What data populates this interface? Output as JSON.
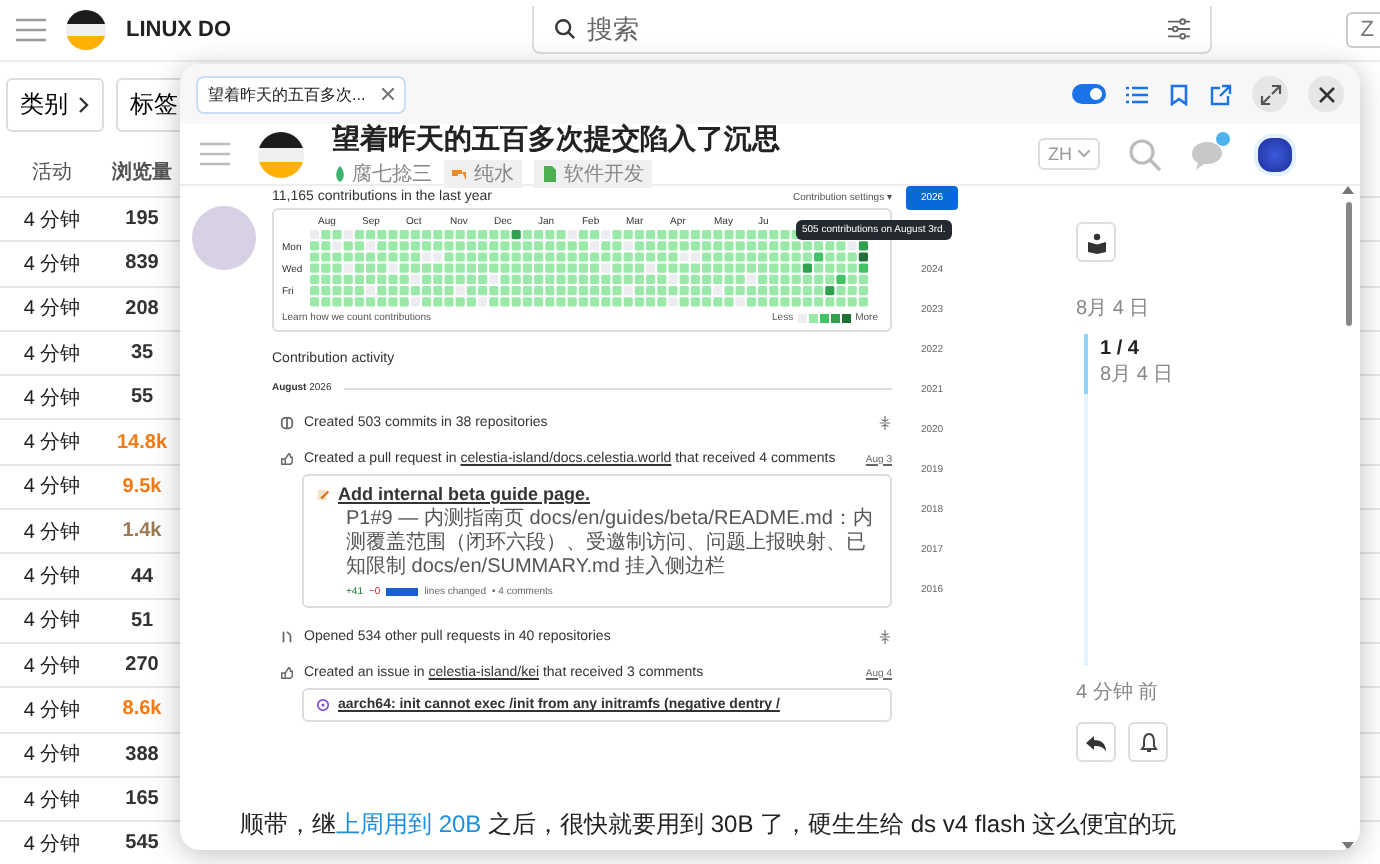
{
  "site": {
    "name": "LINUX DO",
    "search_placeholder": "搜索",
    "lang_partial": "Z"
  },
  "filters": [
    {
      "label": "类别"
    },
    {
      "label": "标签"
    }
  ],
  "table": {
    "columns": [
      "活动",
      "浏览量"
    ],
    "rows": [
      {
        "activity": "4 分钟",
        "views": "195",
        "color": "#333333"
      },
      {
        "activity": "4 分钟",
        "views": "839",
        "color": "#333333"
      },
      {
        "activity": "4 分钟",
        "views": "208",
        "color": "#333333"
      },
      {
        "activity": "4 分钟",
        "views": "35",
        "color": "#333333"
      },
      {
        "activity": "4 分钟",
        "views": "55",
        "color": "#333333"
      },
      {
        "activity": "4 分钟",
        "views": "14.8k",
        "color": "#f27b13"
      },
      {
        "activity": "4 分钟",
        "views": "9.5k",
        "color": "#f27b13"
      },
      {
        "activity": "4 分钟",
        "views": "1.4k",
        "color": "#9c7a54"
      },
      {
        "activity": "4 分钟",
        "views": "44",
        "color": "#333333"
      },
      {
        "activity": "4 分钟",
        "views": "51",
        "color": "#333333"
      },
      {
        "activity": "4 分钟",
        "views": "270",
        "color": "#333333"
      },
      {
        "activity": "4 分钟",
        "views": "8.6k",
        "color": "#f27b13"
      },
      {
        "activity": "4 分钟",
        "views": "388",
        "color": "#333333"
      },
      {
        "activity": "4 分钟",
        "views": "165",
        "color": "#333333"
      },
      {
        "activity": "4 分钟",
        "views": "545",
        "color": "#333333"
      }
    ]
  },
  "popup": {
    "tab": {
      "label": "望着昨天的五百多次..."
    },
    "toggle_on": true,
    "topic": {
      "title": "望着昨天的五百多次提交陷入了沉思",
      "author": "腐七捻三",
      "tags": [
        {
          "label": "纯水",
          "kind": "water"
        },
        {
          "label": "软件开发",
          "kind": "doc"
        }
      ]
    },
    "lang": "ZH",
    "has_unread": true,
    "screenshot": {
      "summary": "11,165 contributions in the last year",
      "settings": "Contribution settings",
      "settings_caret": "▾",
      "months": [
        "Aug",
        "Sep",
        "Oct",
        "Nov",
        "Dec",
        "Jan",
        "Feb",
        "Mar",
        "Apr",
        "May",
        "Ju"
      ],
      "days": [
        "Mon",
        "Wed",
        "Fri"
      ],
      "learn": "Learn how we count contributions",
      "less": "Less",
      "more": "More",
      "tooltip": "505 contributions on August 3rd.",
      "years": [
        {
          "label": "2026",
          "selected": true
        },
        {
          "label": "2024",
          "selected": false
        },
        {
          "label": "2023",
          "selected": false
        },
        {
          "label": "2022",
          "selected": false
        },
        {
          "label": "2021",
          "selected": false
        },
        {
          "label": "2020",
          "selected": false
        },
        {
          "label": "2019",
          "selected": false
        },
        {
          "label": "2018",
          "selected": false
        },
        {
          "label": "2017",
          "selected": false
        },
        {
          "label": "2016",
          "selected": false
        }
      ],
      "activity_title": "Contribution activity",
      "period_month": "August",
      "period_year": "2026",
      "events": [
        {
          "kind": "commits",
          "text": "Created 503 commits in 38 repositories"
        },
        {
          "kind": "pr",
          "pre": "Created a pull request in ",
          "repo": "celestia-island/docs.celestia.world",
          "post": " that received 4 comments",
          "date": "Aug 3",
          "card": {
            "title": "Add internal beta guide page.",
            "body": "P1#9 — 内测指南页 docs/en/guides/beta/README.md：内测覆盖范围（闭环六段）、受邀制访问、问题上报映射、已知限制 docs/en/SUMMARY.md 挂入侧边栏",
            "added": "+41",
            "removed": "−0",
            "lines": "lines changed",
            "comments": "• 4 comments"
          }
        },
        {
          "kind": "opened",
          "text": "Opened 534 other pull requests in 40 repositories"
        },
        {
          "kind": "issue",
          "pre": "Created an issue in ",
          "repo": "celestia-island/kei",
          "post": " that received 3 comments",
          "date": "Aug 4",
          "card": {
            "title": "aarch64: init cannot exec /init from any initramfs (negative dentry /"
          }
        }
      ]
    },
    "post": {
      "pre": "顺带，继",
      "link": "上周用到 20B",
      "post": " 之后，很快就要用到 30B 了，硬生生给 ds v4 flash 这么便宜的玩"
    },
    "timeline": {
      "date_top": "8月 4 日",
      "position": "1 / 4",
      "position_date": "8月 4 日",
      "date_bottom": "4 分钟 前"
    }
  }
}
